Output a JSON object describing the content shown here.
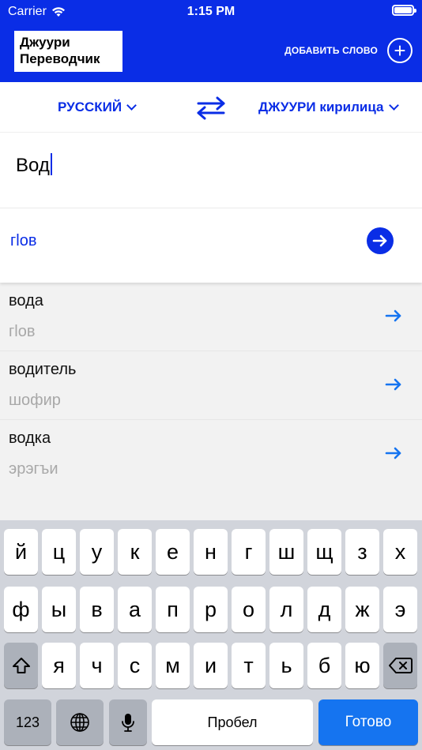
{
  "status_bar": {
    "carrier": "Carrier",
    "time": "1:15 PM"
  },
  "header": {
    "logo_line1": "Джуури",
    "logo_line2": "Переводчик",
    "add_word_label": "ДОБАВИТЬ СЛОВО",
    "add_word_icon": "+"
  },
  "languages": {
    "source": "РУССКИЙ",
    "target": "ДЖУУРИ кирилица"
  },
  "input": {
    "value": "Вод"
  },
  "result": {
    "translation": "гlов"
  },
  "suggestions": [
    {
      "word": "вода",
      "translation": "гlов"
    },
    {
      "word": "водитель",
      "translation": "шофир"
    },
    {
      "word": "водка",
      "translation": "эрэгъи"
    }
  ],
  "keyboard": {
    "row1": [
      "й",
      "ц",
      "у",
      "к",
      "е",
      "н",
      "г",
      "ш",
      "щ",
      "з",
      "х"
    ],
    "row2": [
      "ф",
      "ы",
      "в",
      "а",
      "п",
      "р",
      "о",
      "л",
      "д",
      "ж",
      "э"
    ],
    "row3": [
      "я",
      "ч",
      "с",
      "м",
      "и",
      "т",
      "ь",
      "б",
      "ю"
    ],
    "numbers_label": "123",
    "space_label": "Пробел",
    "done_label": "Готово"
  },
  "colors": {
    "brand_blue": "#0A2DE6",
    "done_blue": "#1574F0",
    "suggestion_arrow": "#1574F0"
  }
}
